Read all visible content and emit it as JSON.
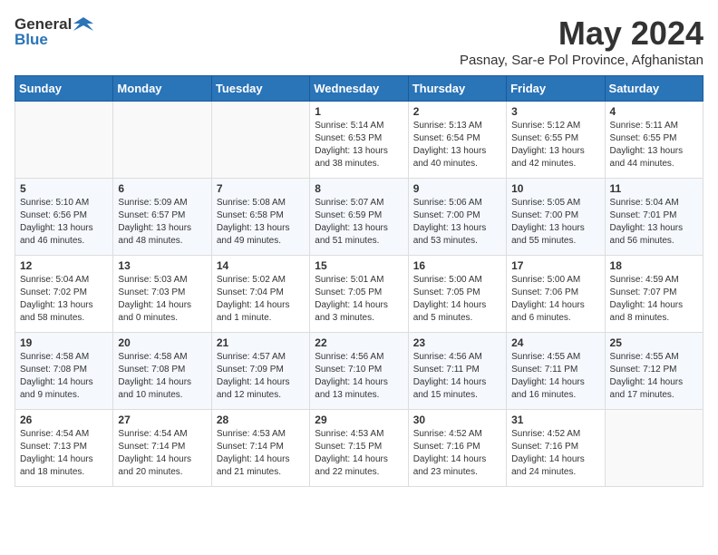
{
  "logo": {
    "general": "General",
    "blue": "Blue"
  },
  "title": "May 2024",
  "subtitle": "Pasnay, Sar-e Pol Province, Afghanistan",
  "days_header": [
    "Sunday",
    "Monday",
    "Tuesday",
    "Wednesday",
    "Thursday",
    "Friday",
    "Saturday"
  ],
  "weeks": [
    [
      {
        "day": "",
        "info": ""
      },
      {
        "day": "",
        "info": ""
      },
      {
        "day": "",
        "info": ""
      },
      {
        "day": "1",
        "info": "Sunrise: 5:14 AM\nSunset: 6:53 PM\nDaylight: 13 hours\nand 38 minutes."
      },
      {
        "day": "2",
        "info": "Sunrise: 5:13 AM\nSunset: 6:54 PM\nDaylight: 13 hours\nand 40 minutes."
      },
      {
        "day": "3",
        "info": "Sunrise: 5:12 AM\nSunset: 6:55 PM\nDaylight: 13 hours\nand 42 minutes."
      },
      {
        "day": "4",
        "info": "Sunrise: 5:11 AM\nSunset: 6:55 PM\nDaylight: 13 hours\nand 44 minutes."
      }
    ],
    [
      {
        "day": "5",
        "info": "Sunrise: 5:10 AM\nSunset: 6:56 PM\nDaylight: 13 hours\nand 46 minutes."
      },
      {
        "day": "6",
        "info": "Sunrise: 5:09 AM\nSunset: 6:57 PM\nDaylight: 13 hours\nand 48 minutes."
      },
      {
        "day": "7",
        "info": "Sunrise: 5:08 AM\nSunset: 6:58 PM\nDaylight: 13 hours\nand 49 minutes."
      },
      {
        "day": "8",
        "info": "Sunrise: 5:07 AM\nSunset: 6:59 PM\nDaylight: 13 hours\nand 51 minutes."
      },
      {
        "day": "9",
        "info": "Sunrise: 5:06 AM\nSunset: 7:00 PM\nDaylight: 13 hours\nand 53 minutes."
      },
      {
        "day": "10",
        "info": "Sunrise: 5:05 AM\nSunset: 7:00 PM\nDaylight: 13 hours\nand 55 minutes."
      },
      {
        "day": "11",
        "info": "Sunrise: 5:04 AM\nSunset: 7:01 PM\nDaylight: 13 hours\nand 56 minutes."
      }
    ],
    [
      {
        "day": "12",
        "info": "Sunrise: 5:04 AM\nSunset: 7:02 PM\nDaylight: 13 hours\nand 58 minutes."
      },
      {
        "day": "13",
        "info": "Sunrise: 5:03 AM\nSunset: 7:03 PM\nDaylight: 14 hours\nand 0 minutes."
      },
      {
        "day": "14",
        "info": "Sunrise: 5:02 AM\nSunset: 7:04 PM\nDaylight: 14 hours\nand 1 minute."
      },
      {
        "day": "15",
        "info": "Sunrise: 5:01 AM\nSunset: 7:05 PM\nDaylight: 14 hours\nand 3 minutes."
      },
      {
        "day": "16",
        "info": "Sunrise: 5:00 AM\nSunset: 7:05 PM\nDaylight: 14 hours\nand 5 minutes."
      },
      {
        "day": "17",
        "info": "Sunrise: 5:00 AM\nSunset: 7:06 PM\nDaylight: 14 hours\nand 6 minutes."
      },
      {
        "day": "18",
        "info": "Sunrise: 4:59 AM\nSunset: 7:07 PM\nDaylight: 14 hours\nand 8 minutes."
      }
    ],
    [
      {
        "day": "19",
        "info": "Sunrise: 4:58 AM\nSunset: 7:08 PM\nDaylight: 14 hours\nand 9 minutes."
      },
      {
        "day": "20",
        "info": "Sunrise: 4:58 AM\nSunset: 7:08 PM\nDaylight: 14 hours\nand 10 minutes."
      },
      {
        "day": "21",
        "info": "Sunrise: 4:57 AM\nSunset: 7:09 PM\nDaylight: 14 hours\nand 12 minutes."
      },
      {
        "day": "22",
        "info": "Sunrise: 4:56 AM\nSunset: 7:10 PM\nDaylight: 14 hours\nand 13 minutes."
      },
      {
        "day": "23",
        "info": "Sunrise: 4:56 AM\nSunset: 7:11 PM\nDaylight: 14 hours\nand 15 minutes."
      },
      {
        "day": "24",
        "info": "Sunrise: 4:55 AM\nSunset: 7:11 PM\nDaylight: 14 hours\nand 16 minutes."
      },
      {
        "day": "25",
        "info": "Sunrise: 4:55 AM\nSunset: 7:12 PM\nDaylight: 14 hours\nand 17 minutes."
      }
    ],
    [
      {
        "day": "26",
        "info": "Sunrise: 4:54 AM\nSunset: 7:13 PM\nDaylight: 14 hours\nand 18 minutes."
      },
      {
        "day": "27",
        "info": "Sunrise: 4:54 AM\nSunset: 7:14 PM\nDaylight: 14 hours\nand 20 minutes."
      },
      {
        "day": "28",
        "info": "Sunrise: 4:53 AM\nSunset: 7:14 PM\nDaylight: 14 hours\nand 21 minutes."
      },
      {
        "day": "29",
        "info": "Sunrise: 4:53 AM\nSunset: 7:15 PM\nDaylight: 14 hours\nand 22 minutes."
      },
      {
        "day": "30",
        "info": "Sunrise: 4:52 AM\nSunset: 7:16 PM\nDaylight: 14 hours\nand 23 minutes."
      },
      {
        "day": "31",
        "info": "Sunrise: 4:52 AM\nSunset: 7:16 PM\nDaylight: 14 hours\nand 24 minutes."
      },
      {
        "day": "",
        "info": ""
      }
    ]
  ]
}
